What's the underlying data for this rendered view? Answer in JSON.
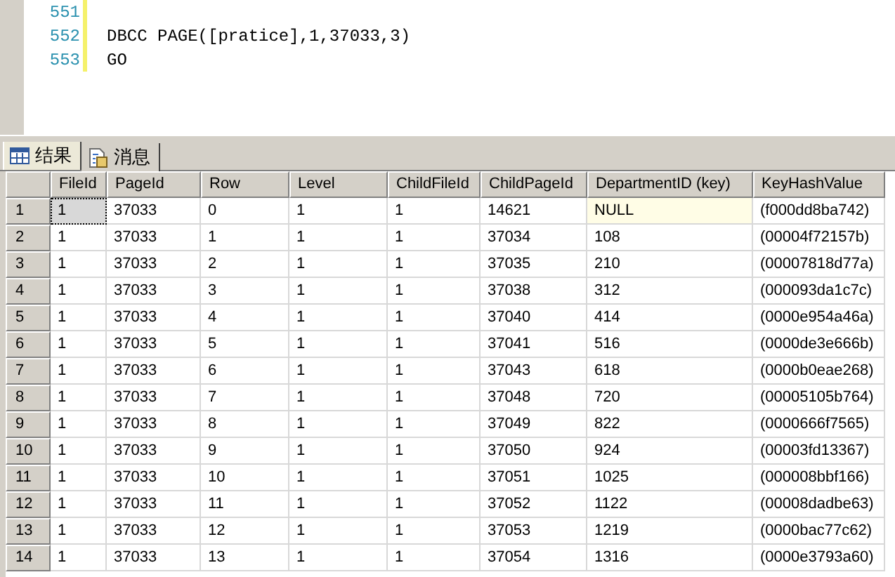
{
  "editor": {
    "lines": [
      {
        "number": "551"
      },
      {
        "number": "552",
        "code": "DBCC PAGE([pratice],1,37033,3)"
      },
      {
        "number": "553",
        "code": "GO"
      }
    ]
  },
  "tabs": [
    {
      "label": "结果",
      "kind": "grid",
      "selected": true
    },
    {
      "label": "消息",
      "kind": "messages",
      "selected": false
    }
  ],
  "table": {
    "columns": [
      "FileId",
      "PageId",
      "Row",
      "Level",
      "ChildFileId",
      "ChildPageId",
      "DepartmentID (key)",
      "KeyHashValue"
    ],
    "rows": [
      {
        "number": "1",
        "cells": [
          "1",
          "37033",
          "0",
          "1",
          "1",
          "14621",
          "NULL",
          "(f000dd8ba742)"
        ],
        "selected": true,
        "key_null": true
      },
      {
        "number": "2",
        "cells": [
          "1",
          "37033",
          "1",
          "1",
          "1",
          "37034",
          "108",
          "(00004f72157b)"
        ],
        "selected": false,
        "key_null": false
      },
      {
        "number": "3",
        "cells": [
          "1",
          "37033",
          "2",
          "1",
          "1",
          "37035",
          "210",
          "(00007818d77a)"
        ],
        "selected": false,
        "key_null": false
      },
      {
        "number": "4",
        "cells": [
          "1",
          "37033",
          "3",
          "1",
          "1",
          "37038",
          "312",
          "(000093da1c7c)"
        ],
        "selected": false,
        "key_null": false
      },
      {
        "number": "5",
        "cells": [
          "1",
          "37033",
          "4",
          "1",
          "1",
          "37040",
          "414",
          "(0000e954a46a)"
        ],
        "selected": false,
        "key_null": false
      },
      {
        "number": "6",
        "cells": [
          "1",
          "37033",
          "5",
          "1",
          "1",
          "37041",
          "516",
          "(0000de3e666b)"
        ],
        "selected": false,
        "key_null": false
      },
      {
        "number": "7",
        "cells": [
          "1",
          "37033",
          "6",
          "1",
          "1",
          "37043",
          "618",
          "(0000b0eae268)"
        ],
        "selected": false,
        "key_null": false
      },
      {
        "number": "8",
        "cells": [
          "1",
          "37033",
          "7",
          "1",
          "1",
          "37048",
          "720",
          "(00005105b764)"
        ],
        "selected": false,
        "key_null": false
      },
      {
        "number": "9",
        "cells": [
          "1",
          "37033",
          "8",
          "1",
          "1",
          "37049",
          "822",
          "(0000666f7565)"
        ],
        "selected": false,
        "key_null": false
      },
      {
        "number": "10",
        "cells": [
          "1",
          "37033",
          "9",
          "1",
          "1",
          "37050",
          "924",
          "(00003fd13367)"
        ],
        "selected": false,
        "key_null": false
      },
      {
        "number": "11",
        "cells": [
          "1",
          "37033",
          "10",
          "1",
          "1",
          "37051",
          "1025",
          "(000008bbf166)"
        ],
        "selected": false,
        "key_null": false
      },
      {
        "number": "12",
        "cells": [
          "1",
          "37033",
          "11",
          "1",
          "1",
          "37052",
          "1122",
          "(00008dadbe63)"
        ],
        "selected": false,
        "key_null": false
      },
      {
        "number": "13",
        "cells": [
          "1",
          "37033",
          "12",
          "1",
          "1",
          "37053",
          "1219",
          "(0000bac77c62)"
        ],
        "selected": false,
        "key_null": false
      },
      {
        "number": "14",
        "cells": [
          "1",
          "37033",
          "13",
          "1",
          "1",
          "37054",
          "1316",
          "(0000e3793a60)"
        ],
        "selected": false,
        "key_null": false
      }
    ]
  }
}
